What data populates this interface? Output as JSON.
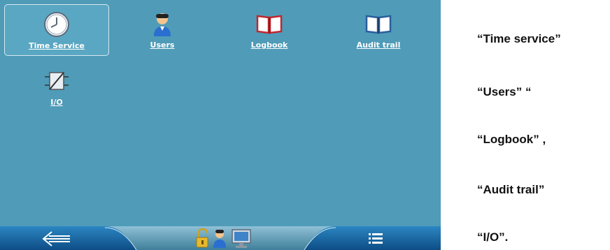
{
  "tiles": [
    {
      "label": "Time Service",
      "icon": "clock-icon"
    },
    {
      "label": "Users",
      "icon": "user-icon"
    },
    {
      "label": "Logbook",
      "icon": "logbook-icon"
    },
    {
      "label": "Audit trail",
      "icon": "audit-trail-icon"
    },
    {
      "label": "I/O",
      "icon": "io-icon"
    }
  ],
  "bottom_bar": {
    "back_icon": "back-arrow-icon",
    "menu_icon": "list-menu-icon",
    "status_icons": [
      "unlock-icon",
      "user-icon",
      "monitor-icon"
    ]
  },
  "captions": [
    "“Time service”",
    "“Users” “",
    "“Logbook” ,",
    "“Audit trail”",
    "“I/O”."
  ],
  "colors": {
    "background": "#4f9bb8",
    "bar": "#1f6fa6"
  }
}
